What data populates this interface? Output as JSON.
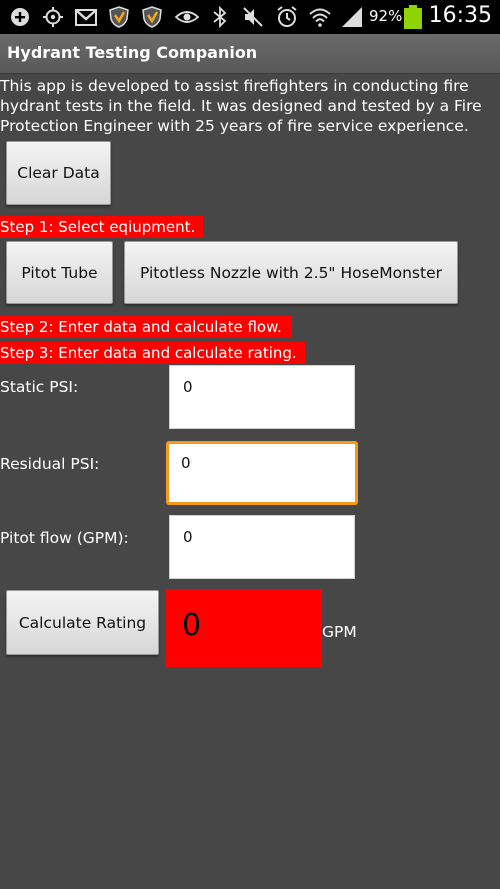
{
  "status_bar": {
    "battery": "92%",
    "time": "16:35",
    "icons": [
      "add-icon",
      "gps-icon",
      "gmail-icon",
      "shield-icon",
      "shield-icon",
      "eye-icon",
      "bluetooth-icon",
      "mute-icon",
      "alarm-icon",
      "wifi-icon",
      "signal-icon",
      "battery-icon"
    ]
  },
  "app": {
    "title": "Hydrant Testing Companion",
    "description": "This app is developed to assist firefighters in conducting fire hydrant tests in the field. It was designed and tested by a Fire Protection Engineer with 25 years of fire service experience."
  },
  "buttons": {
    "clear": "Clear Data",
    "pitot_tube": "Pitot Tube",
    "pitotless": "Pitotless Nozzle with 2.5\" HoseMonster",
    "calculate": "Calculate Rating"
  },
  "steps": {
    "step1": "Step 1: Select eqiupment.",
    "step2": "Step 2: Enter data and calculate flow.",
    "step3": "Step 3: Enter data and calculate rating."
  },
  "fields": {
    "static_label": "Static PSI:",
    "static_value": "0",
    "residual_label": "Residual PSI:",
    "residual_value": "0",
    "pitot_label": "Pitot flow (GPM):",
    "pitot_value": "0"
  },
  "result": {
    "value": "0",
    "unit": "GPM"
  },
  "colors": {
    "background": "#474747",
    "highlight": "#ff0000",
    "focus": "#f39a1e"
  }
}
